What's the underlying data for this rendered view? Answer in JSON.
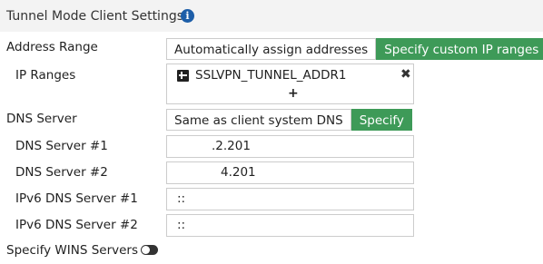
{
  "section": {
    "title": "Tunnel Mode Client Settings",
    "info_icon": "info-icon"
  },
  "address_range": {
    "label": "Address Range",
    "options": [
      "Automatically assign addresses",
      "Specify custom IP ranges"
    ],
    "selected": "Specify custom IP ranges"
  },
  "ip_ranges": {
    "label": "IP Ranges",
    "entries": [
      "SSLVPN_TUNNEL_ADDR1"
    ],
    "entry_icon": "address-object-icon",
    "remove_icon": "✖",
    "add_icon": "+"
  },
  "dns_server": {
    "label": "DNS Server",
    "options": [
      "Same as client system DNS",
      "Specify"
    ],
    "selected": "Specify"
  },
  "dns_fields": [
    {
      "label": "DNS Server #1",
      "value": ".2.201"
    },
    {
      "label": "DNS Server #2",
      "value": "4.201"
    },
    {
      "label": "IPv6 DNS Server #1",
      "value": "::"
    },
    {
      "label": "IPv6 DNS Server #2",
      "value": "::"
    }
  ],
  "wins": {
    "label": "Specify WINS Servers",
    "enabled": false
  },
  "colors": {
    "active": "#3e9a58",
    "info": "#1d5ea8",
    "header_bg": "#f3f3f3"
  }
}
